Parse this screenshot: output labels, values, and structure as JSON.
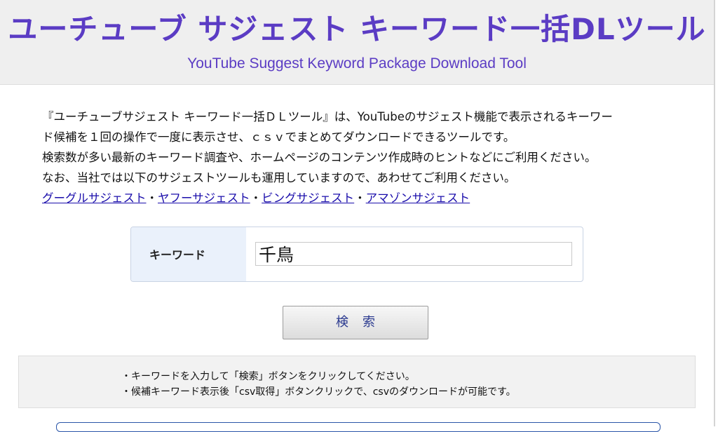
{
  "header": {
    "title_jp": "ユーチューブ サジェスト キーワード一括DLツール",
    "title_en": "YouTube  Suggest Keyword Package Download Tool"
  },
  "intro": {
    "line1": "『ユーチューブサジェスト キーワード一括ＤＬツール』は、YouTubeのサジェスト機能で表示されるキーワー",
    "line2": "ド候補を１回の操作で一度に表示させ、ｃｓｖでまとめてダウンロードできるツールです。",
    "line3": "検索数が多い最新のキーワード調査や、ホームページのコンテンツ作成時のヒントなどにご利用ください。",
    "line4": "なお、当社では以下のサジェストツールも運用していますので、あわせてご利用ください。"
  },
  "links": {
    "items": [
      "グーグルサジェスト",
      "ヤフーサジェスト",
      "ビングサジェスト",
      "アマゾンサジェスト"
    ],
    "separator": "・",
    "color": "#1a0dab"
  },
  "form": {
    "keyword_label": "キーワード",
    "keyword_value": "千鳥"
  },
  "search_button": {
    "label": "検索"
  },
  "notes": {
    "line1": "・キーワードを入力して「検索」ボタンをクリックしてください。",
    "line2": "・候補キーワード表示後「csv取得」ボタンクリックで、csvのダウンロードが可能です。"
  },
  "colors": {
    "title": "#5b3cc4",
    "header_bg": "#efefef",
    "label_cell_bg": "#eaf1fb",
    "button_text": "#2b3a8f"
  }
}
